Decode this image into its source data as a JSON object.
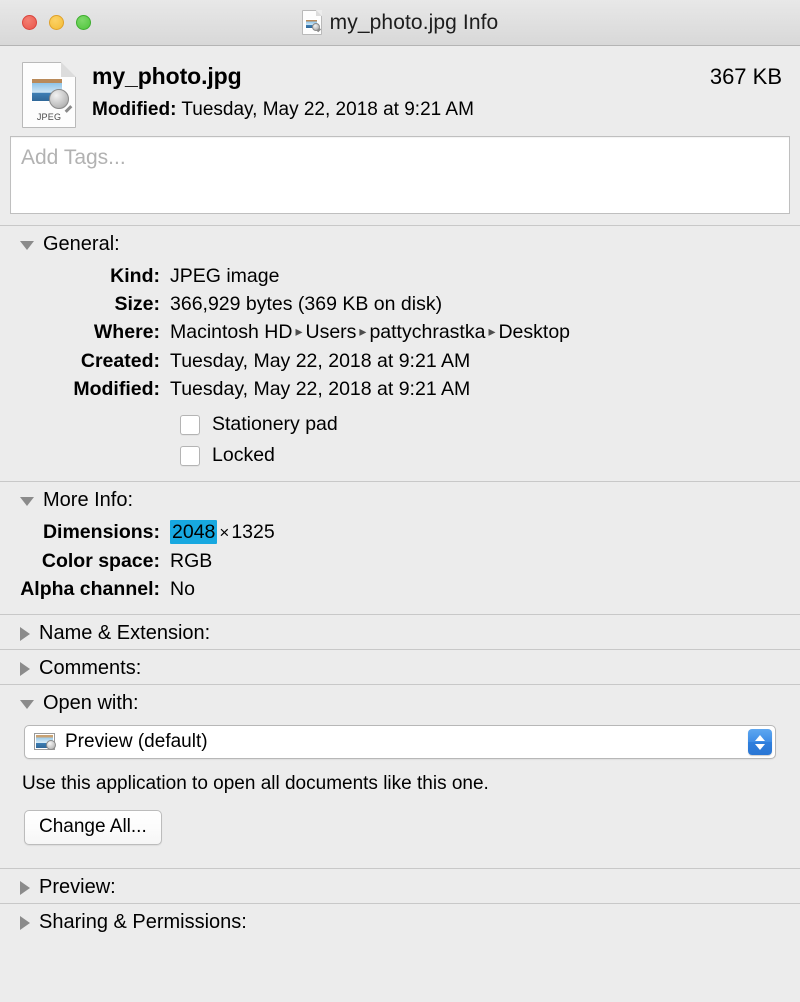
{
  "window": {
    "title": "my_photo.jpg Info",
    "title_icon": "jpeg-document-icon",
    "traffic_lights": {
      "close": "close-button",
      "minimize": "minimize-button",
      "zoom": "zoom-button"
    }
  },
  "header": {
    "icon": "jpeg-document-icon",
    "icon_extension_label": "JPEG",
    "filename": "my_photo.jpg",
    "modified_label": "Modified:",
    "modified_value": "Tuesday, May 22, 2018 at 9:21 AM",
    "size": "367 KB"
  },
  "tags": {
    "placeholder": "Add Tags...",
    "value": ""
  },
  "sections": [
    {
      "id": "general",
      "label": "General:",
      "expanded": true
    },
    {
      "id": "more-info",
      "label": "More Info:",
      "expanded": true
    },
    {
      "id": "name-extension",
      "label": "Name & Extension:",
      "expanded": false
    },
    {
      "id": "comments",
      "label": "Comments:",
      "expanded": false
    },
    {
      "id": "open-with",
      "label": "Open with:",
      "expanded": true
    },
    {
      "id": "preview",
      "label": "Preview:",
      "expanded": false
    },
    {
      "id": "sharing-permissions",
      "label": "Sharing & Permissions:",
      "expanded": false
    }
  ],
  "general": {
    "kind": {
      "label": "Kind:",
      "value": "JPEG image"
    },
    "size": {
      "label": "Size:",
      "value": "366,929 bytes (369 KB on disk)"
    },
    "where": {
      "label": "Where:",
      "path": [
        "Macintosh HD",
        "Users",
        "pattychrastka",
        "Desktop"
      ],
      "separator": "▸"
    },
    "created": {
      "label": "Created:",
      "value": "Tuesday, May 22, 2018 at 9:21 AM"
    },
    "modified": {
      "label": "Modified:",
      "value": "Tuesday, May 22, 2018 at 9:21 AM"
    },
    "stationery_pad": {
      "label": "Stationery pad",
      "checked": false
    },
    "locked": {
      "label": "Locked",
      "checked": false
    }
  },
  "more_info": {
    "dimensions": {
      "label": "Dimensions:",
      "width": "2048",
      "separator": "×",
      "height": "1325",
      "width_selected": true
    },
    "color_space": {
      "label": "Color space:",
      "value": "RGB"
    },
    "alpha_channel": {
      "label": "Alpha channel:",
      "value": "No"
    }
  },
  "open_with": {
    "app_icon": "preview-app-icon",
    "selected_app": "Preview (default)",
    "stepper_icon": "stepper-updown-icon",
    "note": "Use this application to open all documents like this one.",
    "change_all_label": "Change All..."
  },
  "colors": {
    "window_background": "#ececec",
    "titlebar_top": "#e8e8e8",
    "titlebar_bottom": "#d8d8d8",
    "selection_highlight": "#17a8e0",
    "stepper_blue": "#3d8ce6",
    "divider": "#c8c8c8",
    "placeholder_text": "#b2b2b2",
    "close_red": "#e9564b",
    "minimize_yellow": "#f3bb35",
    "zoom_green": "#4fc53c"
  }
}
